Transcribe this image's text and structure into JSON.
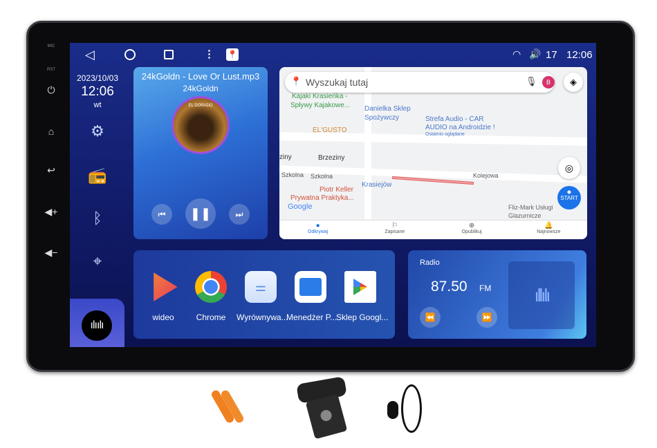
{
  "bezel_buttons": {
    "mic": "MIC",
    "rst": "RST"
  },
  "status_bar": {
    "volume": "17",
    "time": "12:06"
  },
  "sidebar": {
    "date": "2023/10/03",
    "time": "12:06",
    "weekday": "wt"
  },
  "music": {
    "title": "24kGoldn - Love Or Lust.mp3",
    "artist": "24kGoldn",
    "album_text": "EL DORADO"
  },
  "map": {
    "search_placeholder": "Wyszukaj tutaj",
    "avatar_letter": "B",
    "labels": {
      "kajaki": "Kajaki Krasieńka -",
      "kajaki2": "Spływy Kajakowe...",
      "danielka": "Danielka Sklep",
      "danielka2": "Spożywczy",
      "strefa": "Strefa Audio - CAR",
      "strefa2": "AUDIO na Androidzie !",
      "strefa3": "Ostatnio oglądane",
      "elgusto": "EL'GUSTO",
      "brzeziny": "Brzeziny",
      "brzeziny_l": "ziny",
      "szkolna1": "Szkolna",
      "szkolna2": "Szkolna",
      "kolejowa": "Kolejowa",
      "krasiejow": "Krasiejów",
      "piotr": "Piotr Keller",
      "piotr2": "Prywatna Praktyka...",
      "fliz": "Fliz-Mark Usługi",
      "fliz2": "Glazurnicze",
      "google": "Google",
      "start": "START"
    },
    "nav": [
      {
        "label": "Odkrywaj",
        "icon": "pin"
      },
      {
        "label": "Zapisane",
        "icon": "bookmark"
      },
      {
        "label": "Opublikuj",
        "icon": "plus-circle"
      },
      {
        "label": "Najnowsze",
        "icon": "bell"
      }
    ]
  },
  "apps": [
    {
      "label": "wideo"
    },
    {
      "label": "Chrome"
    },
    {
      "label": "Wyrównywa..."
    },
    {
      "label": "Menedżer P..."
    },
    {
      "label": "Sklep Googl..."
    }
  ],
  "radio": {
    "title": "Radio",
    "frequency": "87.50",
    "band": "FM"
  },
  "colors": {
    "accent": "#1a73e8",
    "screen_bg": "#101a66"
  }
}
